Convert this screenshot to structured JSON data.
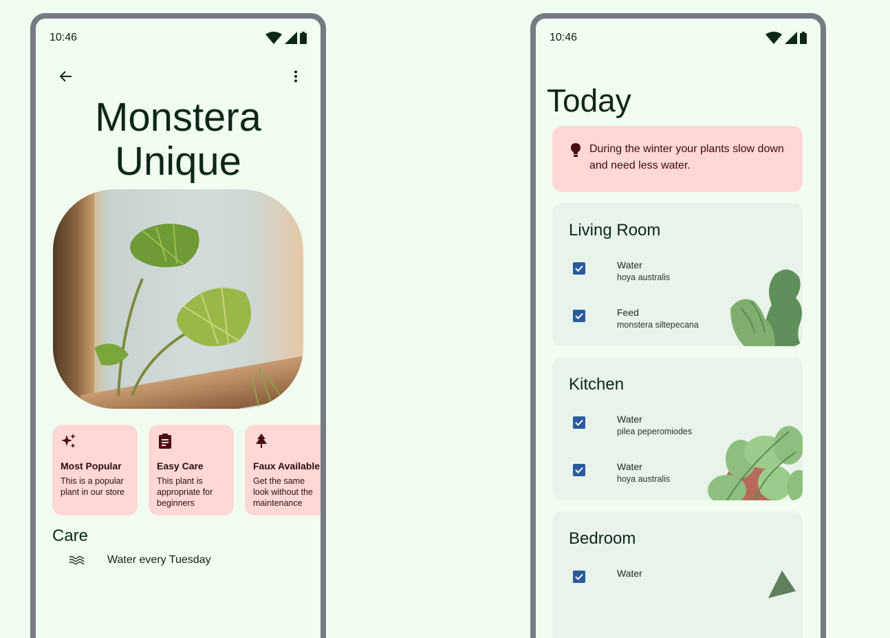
{
  "left_screen": {
    "status": {
      "time": "10:46"
    },
    "title_line1": "Monstera",
    "title_line2": "Unique",
    "chips": [
      {
        "title": "Most Popular",
        "desc": "This is a popular plant in our store",
        "icon": "sparkle-icon"
      },
      {
        "title": "Easy Care",
        "desc": "This plant is appropriate for beginners",
        "icon": "clipboard-icon"
      },
      {
        "title": "Faux Available",
        "desc": "Get the same look without the maintenance",
        "icon": "tree-icon"
      }
    ],
    "care": {
      "title": "Care",
      "items": [
        {
          "label": "Water every Tuesday",
          "icon": "water-waves-icon"
        }
      ]
    }
  },
  "right_screen": {
    "status": {
      "time": "10:46"
    },
    "title": "Today",
    "tip": {
      "text": "During the winter your plants slow down and need less water.",
      "icon": "lightbulb-icon"
    },
    "rooms": [
      {
        "name": "Living Room",
        "tasks": [
          {
            "action": "Water",
            "plant": "hoya australis",
            "checked": true
          },
          {
            "action": "Feed",
            "plant": "monstera siltepecana",
            "checked": true
          }
        ]
      },
      {
        "name": "Kitchen",
        "tasks": [
          {
            "action": "Water",
            "plant": "pilea peperomiodes",
            "checked": true
          },
          {
            "action": "Water",
            "plant": "hoya australis",
            "checked": true
          }
        ]
      },
      {
        "name": "Bedroom",
        "tasks": [
          {
            "action": "Water",
            "plant": "",
            "checked": true
          }
        ]
      }
    ]
  },
  "colors": {
    "background": "#f1fdf0",
    "chip": "#ffd8d6",
    "card": "#e8f3ea",
    "checkbox": "#2a5a9e",
    "frame": "#767b82"
  }
}
